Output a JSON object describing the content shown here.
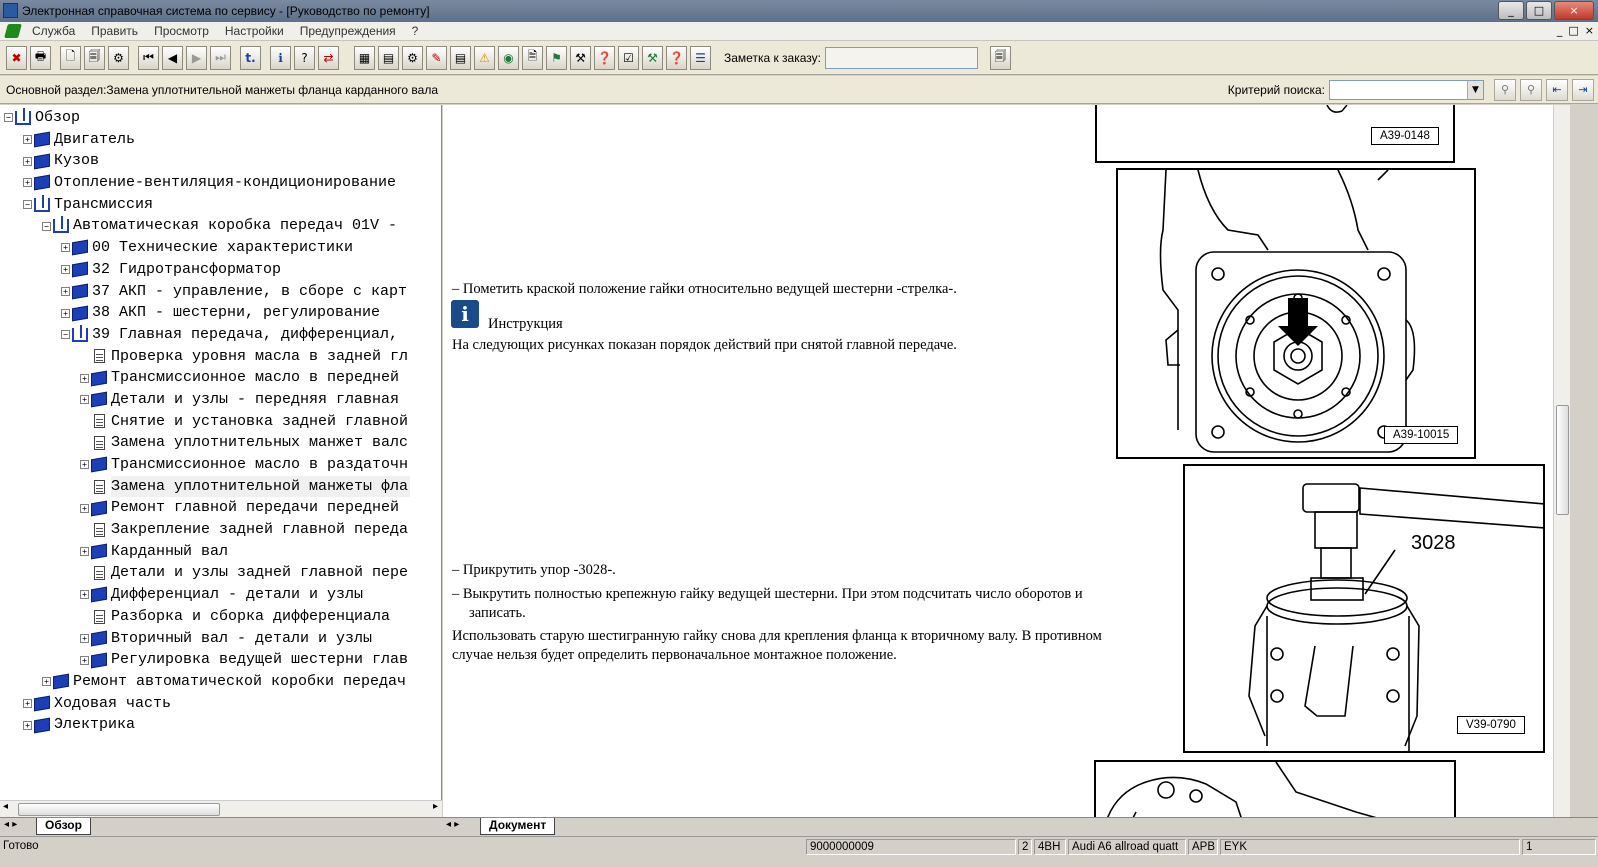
{
  "window": {
    "title": "Электронная справочная система по сервису - [Руководство по ремонту]",
    "controls": [
      "_",
      "□",
      "×"
    ]
  },
  "menubar": {
    "items": [
      "Служба",
      "Править",
      "Просмотр",
      "Настройки",
      "Предупреждения",
      "?"
    ],
    "child_controls": [
      "_",
      "□",
      "×"
    ]
  },
  "toolbar": {
    "buttons_left": [
      "✖",
      "🖶",
      "🗋",
      "🗐",
      "⚙",
      "⏮",
      "◀",
      "▶",
      "⏭",
      "t.",
      "ℹ",
      "?",
      "⇄"
    ],
    "buttons_right": [
      "▦",
      "▤",
      "⚙",
      "✎",
      "▤",
      "⚠",
      "◉",
      "🗎",
      "⚑",
      "⚒",
      "❓",
      "☑",
      "⚒",
      "❓",
      "☰"
    ],
    "order_label": "Заметка к заказу:",
    "order_value": "",
    "order_btn": "🗐"
  },
  "section": {
    "text": "Основной раздел:Замена уплотнительной манжеты фланца карданного вала",
    "search_label": "Критерий  поиска:",
    "search_value": "",
    "search_buttons": [
      "⚲",
      "⚲",
      "⇤",
      "⇥"
    ]
  },
  "tree": [
    {
      "level": 0,
      "pm": "−",
      "icon": "open",
      "label": "Обзор"
    },
    {
      "level": 1,
      "pm": "+",
      "icon": "book",
      "label": "Двигатель"
    },
    {
      "level": 1,
      "pm": "+",
      "icon": "book",
      "label": "Кузов"
    },
    {
      "level": 1,
      "pm": "+",
      "icon": "book",
      "label": "Отопление-вентиляция-кондиционирование"
    },
    {
      "level": 1,
      "pm": "−",
      "icon": "open",
      "label": "Трансмиссия"
    },
    {
      "level": 2,
      "pm": "−",
      "icon": "open",
      "label": "Автоматическая коробка передач 01V -"
    },
    {
      "level": 3,
      "pm": "+",
      "icon": "book",
      "label": "00 Технические характеристики"
    },
    {
      "level": 3,
      "pm": "+",
      "icon": "book",
      "label": "32 Гидротрансформатор"
    },
    {
      "level": 3,
      "pm": "+",
      "icon": "book",
      "label": "37 АКП - управление, в сборе с карт"
    },
    {
      "level": 3,
      "pm": "+",
      "icon": "book",
      "label": "38 АКП - шестерни, регулирование"
    },
    {
      "level": 3,
      "pm": "−",
      "icon": "open",
      "label": "39 Главная передача, дифференциал,"
    },
    {
      "level": 4,
      "pm": "",
      "icon": "doc",
      "label": "Проверка уровня масла в задней гл"
    },
    {
      "level": 4,
      "pm": "+",
      "icon": "book",
      "label": "Трансмиссионное масло в передней"
    },
    {
      "level": 4,
      "pm": "+",
      "icon": "book",
      "label": "Детали и узлы - передняя главная"
    },
    {
      "level": 4,
      "pm": "",
      "icon": "doc",
      "label": "Снятие и установка задней главной"
    },
    {
      "level": 4,
      "pm": "",
      "icon": "doc",
      "label": "Замена уплотнительных манжет валс"
    },
    {
      "level": 4,
      "pm": "+",
      "icon": "book",
      "label": "Трансмиссионное масло в раздаточн"
    },
    {
      "level": 4,
      "pm": "",
      "icon": "doc",
      "label": "Замена уплотнительной манжеты фла",
      "selected": true
    },
    {
      "level": 4,
      "pm": "+",
      "icon": "book",
      "label": "Ремонт главной передачи передней"
    },
    {
      "level": 4,
      "pm": "",
      "icon": "doc",
      "label": "Закрепление задней главной переда"
    },
    {
      "level": 4,
      "pm": "+",
      "icon": "book",
      "label": "Карданный вал"
    },
    {
      "level": 4,
      "pm": "",
      "icon": "doc",
      "label": "Детали и узлы задней главной пере"
    },
    {
      "level": 4,
      "pm": "+",
      "icon": "book",
      "label": "Дифференциал - детали и узлы"
    },
    {
      "level": 4,
      "pm": "",
      "icon": "doc",
      "label": "Разборка и сборка дифференциала"
    },
    {
      "level": 4,
      "pm": "+",
      "icon": "book",
      "label": "Вторичный вал - детали и узлы"
    },
    {
      "level": 4,
      "pm": "+",
      "icon": "book",
      "label": "Регулировка ведущей шестерни глав"
    },
    {
      "level": 2,
      "pm": "+",
      "icon": "book",
      "label": "Ремонт автоматической коробки передач"
    },
    {
      "level": 1,
      "pm": "+",
      "icon": "book",
      "label": "Ходовая часть"
    },
    {
      "level": 1,
      "pm": "+",
      "icon": "book",
      "label": "Электрика"
    }
  ],
  "content": {
    "step1": "–  Пометить краской положение гайки относительно ведущей шестерни -стрелка-.",
    "note_title": "Инструкция",
    "note_text": "На следующих рисунках показан порядок действий при снятой главной передаче.",
    "step2": "–  Прикрутить упор -3028-.",
    "step3a": "–  Выкрутить полностью крепежную гайку ведущей шестерни. При этом подсчитать число оборотов и",
    "step3b": "записать.",
    "para1": "Использовать старую шестигранную гайку снова для крепления фланца к вторичному валу. В противном",
    "para2": "случае нельзя будет определить первоначальное монтажное положение.",
    "figures": {
      "fig1_label": "A39-0148",
      "fig2_label": "A39-10015",
      "fig3_label": "V39-0790",
      "fig3_callout": "3028"
    }
  },
  "tabs": {
    "left": "Обзор",
    "right": "Документ"
  },
  "status": {
    "ready": "Готово",
    "code": "9000000009",
    "num": "2",
    "engine": "4BH",
    "model": "Audi A6 allroad quatt",
    "gear": "APB",
    "code2": "EYK",
    "page": "1"
  }
}
